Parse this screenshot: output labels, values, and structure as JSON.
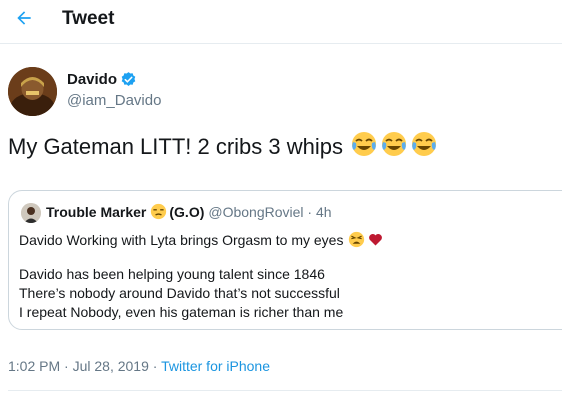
{
  "header": {
    "title": "Tweet",
    "back_icon": "arrow-left-icon",
    "accent": "#1da1f2"
  },
  "author": {
    "display_name": "Davido",
    "handle": "@iam_Davido",
    "verified": true,
    "verified_color": "#1da1f2"
  },
  "tweet": {
    "text": "My Gateman LITT! 2 cribs 3 whips",
    "emojis": [
      "face-with-tears-of-joy-icon",
      "face-with-tears-of-joy-icon",
      "face-with-tears-of-joy-icon"
    ]
  },
  "quoted": {
    "name": "Trouble Marker",
    "name_suffix": "(G.O)",
    "name_emoji": "unamused-face-icon",
    "meta": "@ObongRoviel · 4h",
    "line1": "Davido Working with Lyta brings Orgasm to my eyes",
    "line1_emojis": [
      "weary-face-icon",
      "red-heart-icon"
    ],
    "line2": "Davido has been helping young talent since 1846",
    "line3": "There’s nobody around Davido that’s not successful",
    "line4": "I repeat Nobody, even his gateman is richer than me"
  },
  "footer": {
    "timestamp": "1:02 PM · Jul 28, 2019 · ",
    "source": "Twitter for iPhone",
    "source_color": "#1b95e0"
  }
}
